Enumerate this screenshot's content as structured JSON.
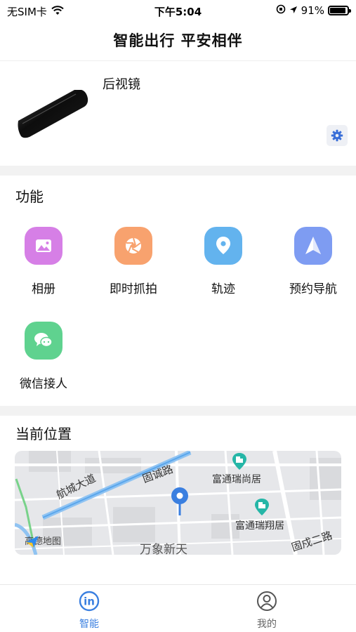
{
  "status_bar": {
    "carrier": "无SIM卡",
    "time": "下午5:04",
    "battery_percent": "91%",
    "battery_level": 0.91
  },
  "header": {
    "title": "智能出行 平安相伴"
  },
  "device": {
    "name": "后视镜"
  },
  "functions": {
    "title": "功能",
    "items": [
      {
        "label": "相册",
        "icon": "photo-album-icon",
        "color": "#d67fe6"
      },
      {
        "label": "即时抓拍",
        "icon": "camera-aperture-icon",
        "color": "#f8a26e"
      },
      {
        "label": "轨迹",
        "icon": "location-pin-icon",
        "color": "#63b3ee"
      },
      {
        "label": "预约导航",
        "icon": "navigation-arrow-icon",
        "color": "#7e9cf2"
      },
      {
        "label": "微信接人",
        "icon": "wechat-chat-icon",
        "color": "#5fd28f"
      }
    ]
  },
  "location": {
    "title": "当前位置",
    "map_labels": {
      "road_1": "航城大道",
      "road_2": "固诚路",
      "poi_1": "富通瑞尚居",
      "poi_2": "富通瑞翔居",
      "area": "万象新天",
      "road_3": "固戍二路",
      "provider": "高德地图"
    }
  },
  "tabbar": {
    "tabs": [
      {
        "label": "智能",
        "active": true
      },
      {
        "label": "我的",
        "active": false
      }
    ]
  },
  "colors": {
    "accent": "#3a7fe0",
    "inactive": "#666666",
    "settings_gear": "#3a6fd8"
  }
}
